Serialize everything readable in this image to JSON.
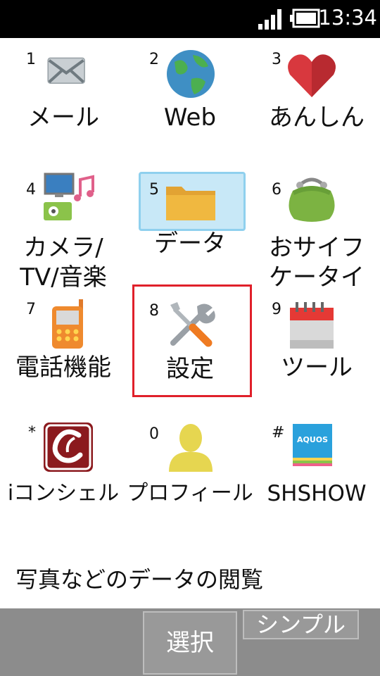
{
  "status_bar": {
    "time": "13:34"
  },
  "menu": {
    "items": [
      {
        "key": "1",
        "label": "メール",
        "icon": "mail-icon"
      },
      {
        "key": "2",
        "label": "Web",
        "icon": "globe-icon"
      },
      {
        "key": "3",
        "label": "あんしん",
        "icon": "heart-icon"
      },
      {
        "key": "4",
        "label": "カメラ/",
        "label2": "TV/音楽",
        "icon": "camera-tv-music-icon"
      },
      {
        "key": "5",
        "label": "データ",
        "icon": "folder-icon"
      },
      {
        "key": "6",
        "label": "おサイフ",
        "label2": "ケータイ",
        "icon": "wallet-icon"
      },
      {
        "key": "7",
        "label": "電話機能",
        "icon": "phone-icon"
      },
      {
        "key": "8",
        "label": "設定",
        "icon": "tools-icon"
      },
      {
        "key": "9",
        "label": "ツール",
        "icon": "calendar-icon"
      },
      {
        "key": "*",
        "label": "iコンシェル",
        "icon": "concier-icon"
      },
      {
        "key": "0",
        "label": "プロフィール",
        "icon": "profile-icon"
      },
      {
        "key": "#",
        "label": "SHSHOW",
        "icon": "aquos-icon",
        "icon_text": "AQUOS"
      }
    ]
  },
  "description": "写真などのデータの閲覧",
  "softkeys": {
    "select": "選択",
    "simple": "シンプル"
  }
}
